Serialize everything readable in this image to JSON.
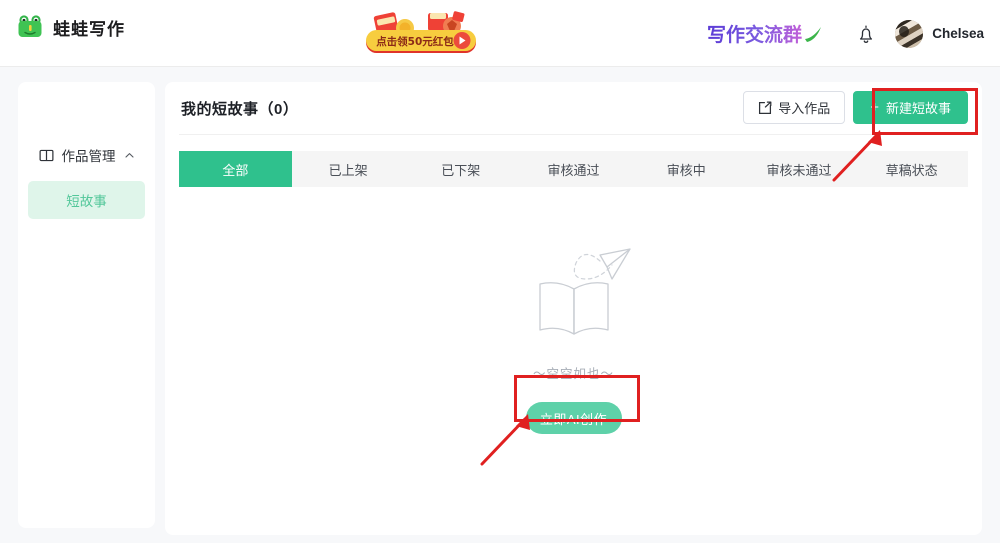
{
  "header": {
    "brand_name": "蛙蛙写作",
    "logo_icon": "frog-icon",
    "promo_text": "点击领50元红包",
    "promo_play_icon": "play-icon",
    "group_link_text": "写作交流群",
    "group_link_icon": "check-swoosh-icon",
    "bell_icon": "bell-icon",
    "avatar_icon": "user-avatar",
    "user_name": "Chelsea"
  },
  "sidebar": {
    "group": {
      "icon": "book-open-icon",
      "label": "作品管理",
      "chevron_icon": "chevron-up-icon",
      "expanded": true
    },
    "items": [
      {
        "label": "短故事",
        "active": true
      }
    ]
  },
  "content": {
    "page_title": "我的短故事（0）",
    "count": 0,
    "actions": {
      "import_label": "导入作品",
      "import_icon": "import-box-icon",
      "new_label": "新建短故事",
      "new_plus_icon": "plus-icon"
    },
    "tabs": [
      {
        "label": "全部",
        "active": true
      },
      {
        "label": "已上架",
        "active": false
      },
      {
        "label": "已下架",
        "active": false
      },
      {
        "label": "审核通过",
        "active": false
      },
      {
        "label": "审核中",
        "active": false
      },
      {
        "label": "审核未通过",
        "active": false
      },
      {
        "label": "草稿状态",
        "active": false
      }
    ],
    "empty_state": {
      "illustration_icon": "open-book-paper-plane-icon",
      "text": "～空空如也～",
      "cta_label": "立即AI创作"
    }
  },
  "colors": {
    "primary_green": "#2fc18d",
    "cta_green": "#5ed1a9",
    "nav_active_bg": "#dff5ea",
    "nav_active_text": "#53c79a",
    "annotation_red": "#e02020",
    "page_bg": "#f7f8fa",
    "tabs_bg": "#f5f5f5"
  },
  "annotations": [
    {
      "name": "new-story-highlight",
      "target": "新建短故事"
    },
    {
      "name": "ai-create-highlight",
      "target": "立即AI创作"
    }
  ]
}
